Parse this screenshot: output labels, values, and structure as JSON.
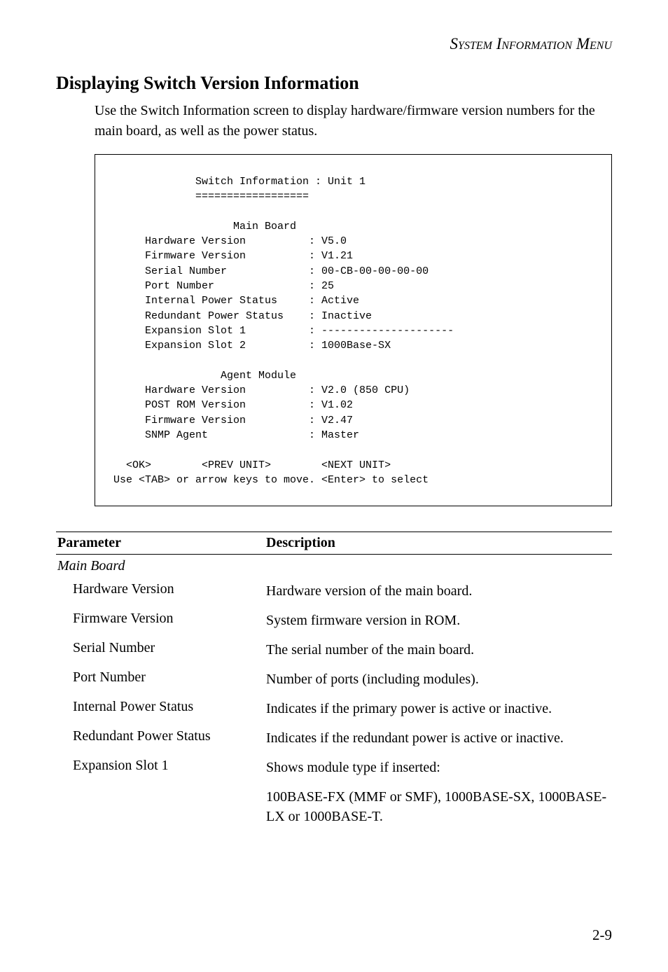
{
  "header": {
    "running_head": "System Information Menu"
  },
  "section": {
    "title": "Displaying Switch Version Information",
    "intro": "Use the Switch Information screen to display hardware/firmware version numbers for the main board, as well as the power status."
  },
  "terminal": {
    "title_line": "             Switch Information : Unit 1",
    "rule_line": "             ==================",
    "mb_head": "                   Main Board",
    "rows": [
      {
        "k": "Hardware Version",
        "v": ": V5.0"
      },
      {
        "k": "Firmware Version",
        "v": ": V1.21"
      },
      {
        "k": "Serial Number",
        "v": ": 00-CB-00-00-00-00"
      },
      {
        "k": "Port Number",
        "v": ": 25"
      },
      {
        "k": "Internal Power Status",
        "v": ": Active"
      },
      {
        "k": "Redundant Power Status",
        "v": ": Inactive"
      },
      {
        "k": "Expansion Slot 1",
        "v": ": ---------------------"
      },
      {
        "k": "Expansion Slot 2",
        "v": ": 1000Base-SX"
      }
    ],
    "am_head": "                 Agent Module",
    "arows": [
      {
        "k": "Hardware Version",
        "v": ": V2.0 (850 CPU)"
      },
      {
        "k": "POST ROM Version",
        "v": ": V1.02"
      },
      {
        "k": "Firmware Version",
        "v": ": V2.47"
      },
      {
        "k": "SNMP Agent",
        "v": ": Master"
      }
    ],
    "nav_line": "  <OK>        <PREV UNIT>        <NEXT UNIT>",
    "hint_line": "Use <TAB> or arrow keys to move. <Enter> to select"
  },
  "table": {
    "head_l": "Parameter",
    "head_r": "Description",
    "group": "Main Board",
    "rows": [
      {
        "l": "Hardware Version",
        "r": "Hardware version of the main board."
      },
      {
        "l": "Firmware Version",
        "r": "System firmware version in ROM."
      },
      {
        "l": "Serial Number",
        "r": "The serial number of the main board."
      },
      {
        "l": "Port Number",
        "r": "Number of ports (including modules)."
      },
      {
        "l": "Internal Power Status",
        "r": "Indicates if the primary power is active or inactive."
      },
      {
        "l": "Redundant Power Status",
        "r": "Indicates if the redundant power is active or inactive."
      },
      {
        "l": "Expansion Slot 1",
        "r": "Shows module type if inserted:"
      },
      {
        "l": "",
        "r": "100BASE-FX (MMF or SMF), 1000BASE-SX, 1000BASE-LX or 1000BASE-T."
      }
    ]
  },
  "page_number": "2-9"
}
